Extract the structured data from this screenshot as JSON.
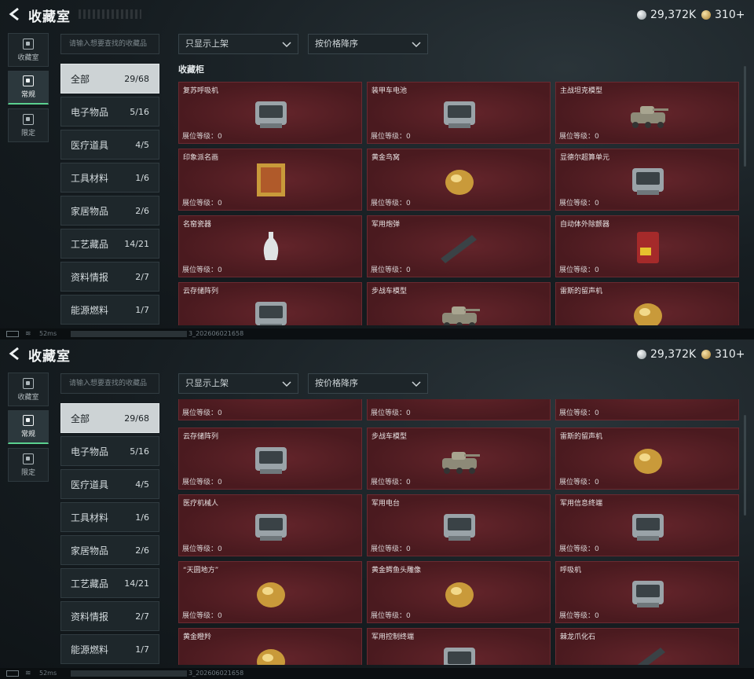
{
  "header": {
    "title": "收藏室",
    "currency_silver": "29,372K",
    "currency_gold": "310+"
  },
  "side_tabs": [
    {
      "label": "收藏室",
      "icon": "collection-icon"
    },
    {
      "label": "常规",
      "icon": "frame-icon"
    },
    {
      "label": "限定",
      "icon": "limited-icon"
    }
  ],
  "search": {
    "placeholder": "请输入想要查找的收藏品"
  },
  "filters": {
    "show": "只显示上架",
    "sort": "按价格降序"
  },
  "categories": [
    {
      "label": "全部",
      "count": "29/68"
    },
    {
      "label": "电子物品",
      "count": "5/16"
    },
    {
      "label": "医疗道具",
      "count": "4/5"
    },
    {
      "label": "工具材料",
      "count": "1/6"
    },
    {
      "label": "家居物品",
      "count": "2/6"
    },
    {
      "label": "工艺藏品",
      "count": "14/21"
    },
    {
      "label": "资料情报",
      "count": "2/7"
    },
    {
      "label": "能源燃料",
      "count": "1/7"
    }
  ],
  "section_title": "收藏柜",
  "level_label": "展位等级：0",
  "items_top": [
    {
      "name": "复苏呼吸机",
      "icon": "ventilator-icon"
    },
    {
      "name": "装甲车电池",
      "icon": "battery-icon"
    },
    {
      "name": "主战坦克模型",
      "icon": "tank-icon"
    },
    {
      "name": "印象派名画",
      "icon": "painting-icon"
    },
    {
      "name": "黄金鸟窝",
      "icon": "golden-nest-icon"
    },
    {
      "name": "显德尔超算单元",
      "icon": "computer-unit-icon"
    },
    {
      "name": "名窑瓷器",
      "icon": "vase-icon"
    },
    {
      "name": "军用炮弹",
      "icon": "shell-icon"
    },
    {
      "name": "自动体外除颤器",
      "icon": "defibrillator-icon"
    },
    {
      "name": "云存储阵列",
      "icon": "storage-array-icon"
    },
    {
      "name": "步战车模型",
      "icon": "ifv-icon"
    },
    {
      "name": "雷斯的留声机",
      "icon": "gramophone-icon"
    }
  ],
  "items_bottom": [
    {
      "name": "云存储阵列",
      "icon": "storage-array-icon"
    },
    {
      "name": "步战车模型",
      "icon": "ifv-icon"
    },
    {
      "name": "雷斯的留声机",
      "icon": "gramophone-icon"
    },
    {
      "name": "医疗机械人",
      "icon": "medical-robot-icon"
    },
    {
      "name": "军用电台",
      "icon": "radio-icon"
    },
    {
      "name": "军用信息终端",
      "icon": "terminal-icon"
    },
    {
      "name": "“天圆地方”",
      "icon": "armillary-icon"
    },
    {
      "name": "黄金鳄鱼头雕像",
      "icon": "crocodile-icon"
    },
    {
      "name": "呼吸机",
      "icon": "breathing-machine-icon"
    },
    {
      "name": "黄金瞪羚",
      "icon": "gazelle-icon"
    },
    {
      "name": "军用控制终端",
      "icon": "control-terminal-icon"
    },
    {
      "name": "棘龙爪化石",
      "icon": "claw-fossil-icon"
    }
  ],
  "status": {
    "ping": "52ms",
    "build": "3_202606021658"
  }
}
